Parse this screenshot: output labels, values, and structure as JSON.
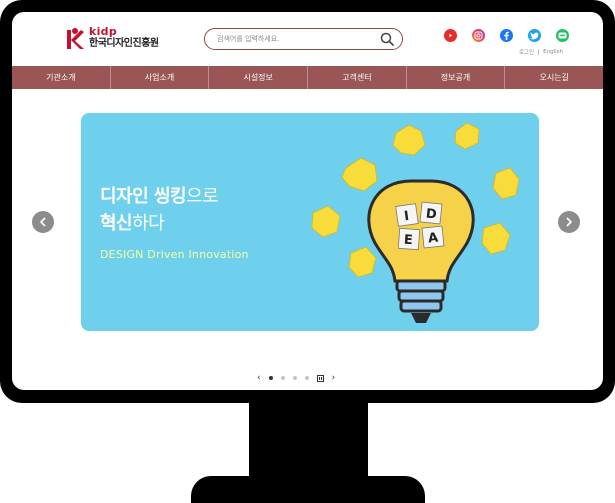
{
  "header": {
    "logo_en": "kidp",
    "logo_ko": "한국디자인진흥원",
    "search_placeholder": "검색어를 입력하세요.",
    "social": [
      "youtube-icon",
      "instagram-icon",
      "facebook-icon",
      "twitter-icon",
      "blog-icon"
    ],
    "util_links": {
      "login": "로그인",
      "english": "English"
    }
  },
  "nav": {
    "items": [
      "기관소개",
      "사업소개",
      "시설정보",
      "고객센터",
      "정보공개",
      "오시는길"
    ]
  },
  "banner": {
    "title_line1_bold": "디자인 씽킹",
    "title_line1_rest": "으로",
    "title_line2_bold": "혁신",
    "title_line2_rest": "하다",
    "subtitle": "DESIGN Driven Innovation",
    "cube_letters": [
      "I",
      "D",
      "E",
      "A"
    ]
  },
  "pager": {
    "prev": "‹",
    "next": "›",
    "dot_count": 4,
    "active_index": 0
  },
  "colors": {
    "brand_red": "#c8102e",
    "nav_bg": "#9a5555",
    "banner_bg": "#6fd0ee",
    "subtitle": "#f4ffa0"
  }
}
